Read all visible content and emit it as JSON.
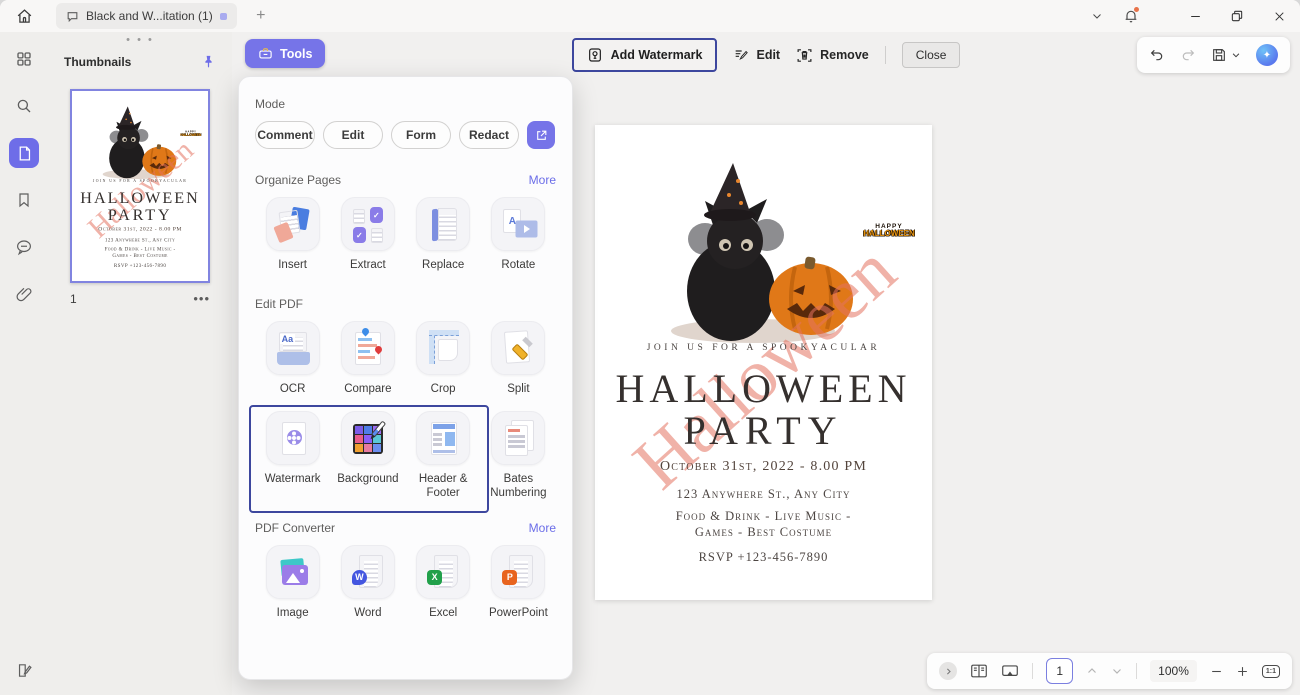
{
  "window": {
    "tab_title": "Black and W...itation (1)"
  },
  "sidebar": {
    "thumbnails_title": "Thumbnails",
    "page_number": "1"
  },
  "toolbar": {
    "tools_label": "Tools",
    "add_watermark_label": "Add Watermark",
    "edit_label": "Edit",
    "remove_label": "Remove",
    "close_label": "Close"
  },
  "tools_panel": {
    "mode": {
      "label": "Mode",
      "buttons": [
        "Comment",
        "Edit",
        "Form",
        "Redact"
      ]
    },
    "organize": {
      "title": "Organize Pages",
      "more": "More",
      "items": [
        "Insert",
        "Extract",
        "Replace",
        "Rotate"
      ]
    },
    "edit_pdf": {
      "title": "Edit PDF",
      "row1": [
        "OCR",
        "Compare",
        "Crop",
        "Split"
      ],
      "row2": [
        "Watermark",
        "Background",
        "Header & Footer",
        "Bates Numbering"
      ]
    },
    "converter": {
      "title": "PDF Converter",
      "more": "More",
      "items": [
        "Image",
        "Word",
        "Excel",
        "PowerPoint"
      ]
    }
  },
  "icon_letters": {
    "ocr": "Aa",
    "rotate": "A",
    "word": "W",
    "excel": "X",
    "powerpoint": "P",
    "fit": "1:1"
  },
  "document": {
    "tagline": "JOIN US FOR A SPOOKYACULAR",
    "title_line1": "HALLOWEEN",
    "title_line2": "PARTY",
    "date_line": "October 31st, 2022 - 8.00 PM",
    "address": "123 Anywhere St., Any City",
    "details_line1": "Food & Drink - Live Music -",
    "details_line2": "Games - Best Costume",
    "rsvp": "RSVP +123-456-7890",
    "watermark_text": "Halloween",
    "sticker_line1": "HAPPY",
    "sticker_line2": "HALLOWEEN"
  },
  "status_bar": {
    "page": "1",
    "zoom": "100%"
  },
  "colors": {
    "accent": "#6e6de8",
    "highlight_border": "#3d479e",
    "watermark": "#e47360",
    "selection_border": "#8184e0"
  }
}
